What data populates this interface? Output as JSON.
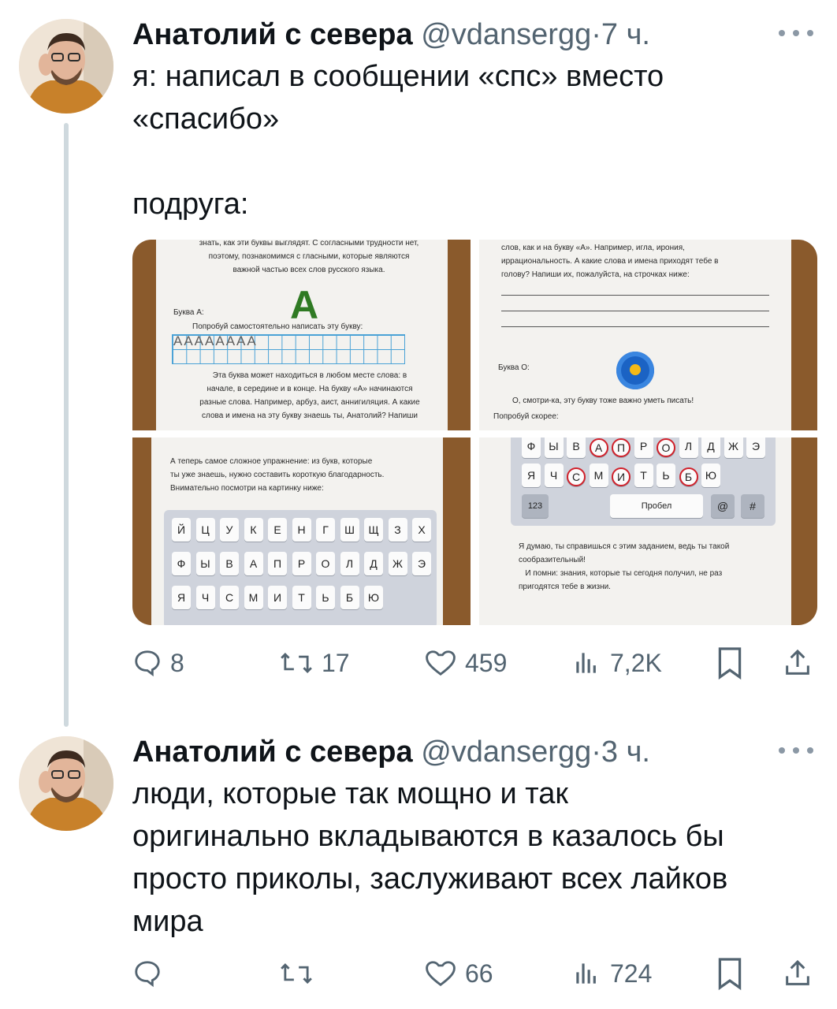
{
  "tweets": [
    {
      "author_name": "Анатолий с севера",
      "handle": "@vdansergg",
      "separator": "·",
      "time": "7 ч.",
      "text": "я: написал в сообщении «спс» вместо\n«спасибо»\n\nподруга:",
      "media": {
        "panel1": {
          "intro": "знать, как эти буквы выглядят. С согласными трудности нет,\nпоэтому, познакомимся с гласными, которые являются\nважной частью всех слов русского языка.",
          "letter_label": "Буква А:",
          "prompt": "Попробуй самостоятельно написать эту букву:",
          "big_letter": "А",
          "letters": "АААААААА",
          "body": "Эта буква может находиться в любом месте слова: в\nначале, в середине и в конце. На букву «А» начинаются\nразные слова. Например, арбуз, аист, аннигиляция. А какие\nслова и имена на эту букву знаешь ты, Анатолий? Напиши"
        },
        "panel2": {
          "body": "слов, как и на букву «А». Например, игла, ирония,\nиррациональность. А какие слова и имена приходят тебе в\nголову? Напиши их, пожалуйста, на строчках ниже:",
          "letter_label": "Буква О:",
          "body2": "О, смотри-ка, эту букву тоже важно уметь писать!",
          "prompt": "Попробуй скорее:"
        },
        "panel3": {
          "body": "А теперь самое сложное упражнение: из букв, которые\nты уже знаешь, нужно составить короткую благодарность.\nВнимательно посмотри на картинку ниже:",
          "row1": [
            "Й",
            "Ц",
            "У",
            "К",
            "Е",
            "Н",
            "Г",
            "Ш",
            "Щ",
            "З",
            "Х"
          ],
          "row2": [
            "Ф",
            "Ы",
            "В",
            "А",
            "П",
            "Р",
            "О",
            "Л",
            "Д",
            "Ж",
            "Э"
          ],
          "row3": [
            "Я",
            "Ч",
            "С",
            "М",
            "И",
            "Т",
            "Ь",
            "Б",
            "Ю"
          ]
        },
        "panel4": {
          "row1": [
            "Ф",
            "Ы",
            "В",
            "А",
            "П",
            "Р",
            "О",
            "Л",
            "Д",
            "Ж",
            "Э"
          ],
          "row2": [
            "Я",
            "Ч",
            "С",
            "М",
            "И",
            "Т",
            "Ь",
            "Б",
            "Ю"
          ],
          "key_123": "123",
          "key_space": "Пробел",
          "key_at": "@",
          "key_hash": "#",
          "body": "Я думаю, ты справишься с этим заданием, ведь ты такой\nсообразительный!\n   И помни: знания, которые ты сегодня получил, не раз\nпригодятся тебе в жизни."
        }
      },
      "replies": "8",
      "retweets": "17",
      "likes": "459",
      "views": "7,2K"
    },
    {
      "author_name": "Анатолий с севера",
      "handle": "@vdansergg",
      "separator": "·",
      "time": "3 ч.",
      "text": "люди, которые так мощно и так\nоригинально вкладываются в казалось бы\nпросто приколы, заслуживают всех лайков\nмира",
      "likes": "66",
      "views": "724"
    }
  ],
  "colors": {
    "text": "#0f1419",
    "muted": "#536471",
    "thread_line": "#cfd9de",
    "circle_red": "#d0202a"
  },
  "icons": [
    "more-icon",
    "reply-icon",
    "retweet-icon",
    "like-icon",
    "views-icon",
    "bookmark-icon",
    "share-icon"
  ]
}
